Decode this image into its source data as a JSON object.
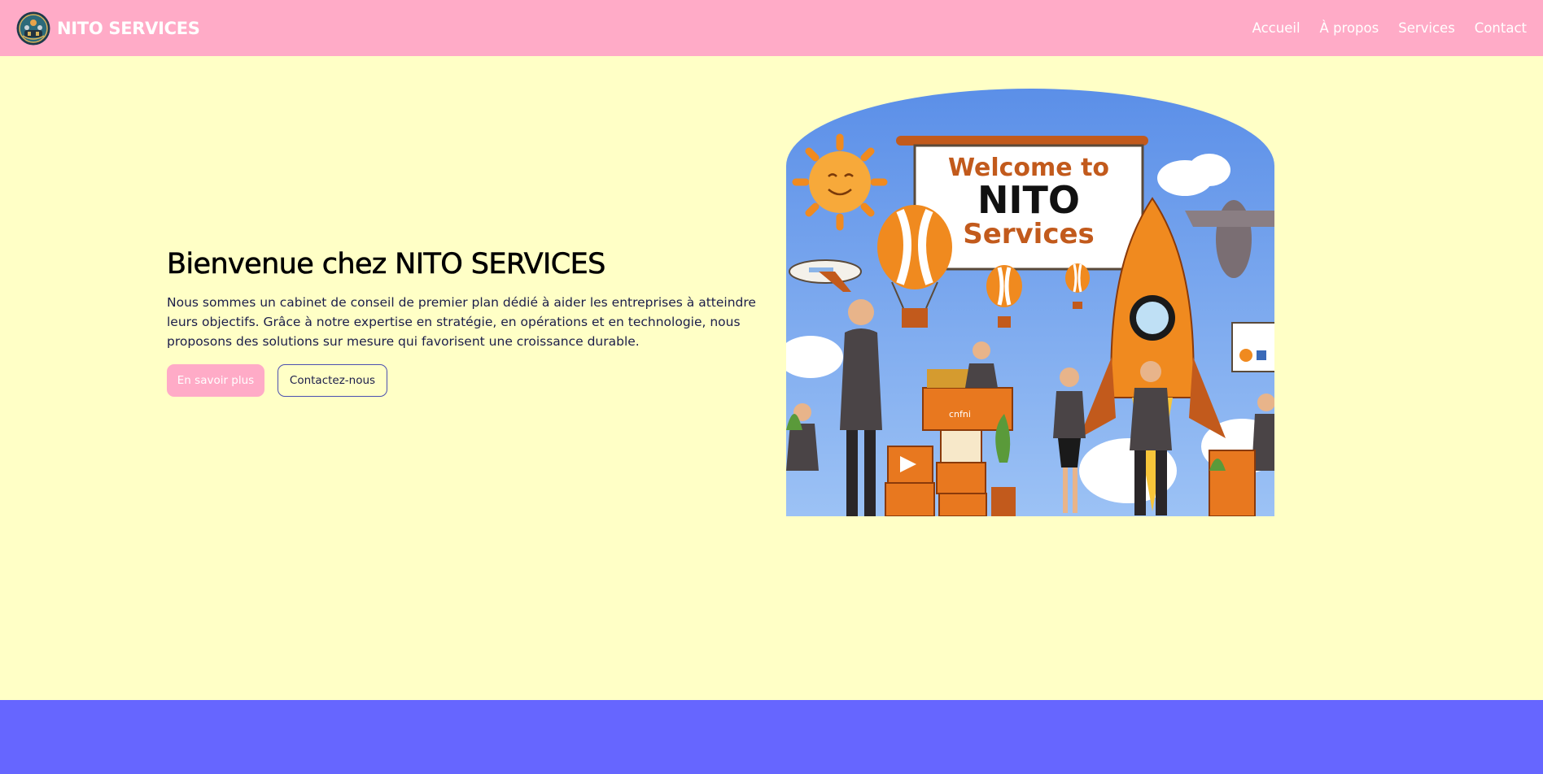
{
  "nav": {
    "brand": "NITO SERVICES",
    "links": [
      "Accueil",
      "À propos",
      "Services",
      "Contact"
    ]
  },
  "hero": {
    "title": "Bienvenue chez NITO SERVICES",
    "description": "Nous sommes un cabinet de conseil de premier plan dédié à aider les entreprises à atteindre leurs objectifs. Grâce à notre expertise en stratégie, en opérations et en technologie, nous proposons des solutions sur mesure qui favorisent une croissance durable.",
    "primary_button": "En savoir plus",
    "secondary_button": "Contactez-nous",
    "image": {
      "banner_line1": "Welcome to",
      "banner_line2": "NITO",
      "banner_line3": "Services",
      "box_label": "cnfni"
    }
  },
  "colors": {
    "navbar": "#ffabc7",
    "hero_bg": "#ffffc6",
    "footer_band": "#6666ff",
    "text_dark": "#1b1d4a",
    "outline": "#4b4fb0"
  },
  "icons": {
    "logo": "company-logo-emblem"
  }
}
